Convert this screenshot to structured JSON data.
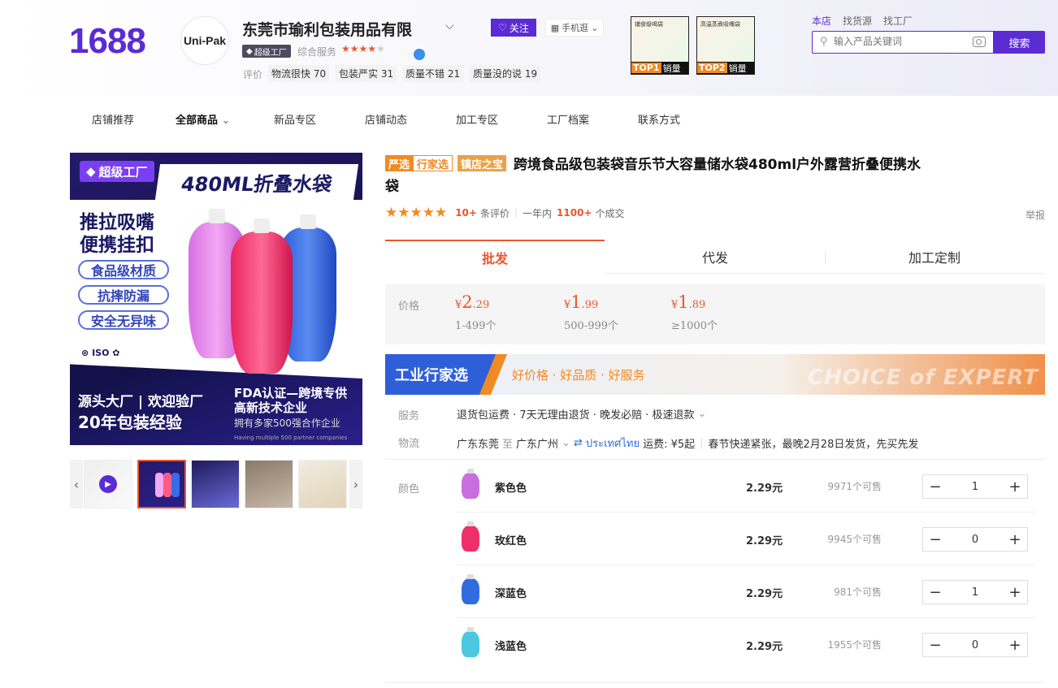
{
  "header": {
    "logo": "1688",
    "shop_avatar": "Uni-Pak",
    "shop_name": "东莞市瑜利包装用品有限",
    "follow_label": "关注",
    "mobile_label": "手机逛",
    "super_factory_badge": "超级工厂",
    "overall_service_label": "综合服务",
    "overall_stars": 4,
    "review_label": "评价",
    "review_chips": [
      "物流很快 70",
      "包装严实 31",
      "质量不错 21",
      "质量没的说 19"
    ],
    "top_products": [
      {
        "caption": "铺食级喝袋",
        "rank": "TOP1",
        "label": "销量"
      },
      {
        "caption": "高温蒸煮吸嘴袋",
        "rank": "TOP2",
        "label": "销量"
      }
    ],
    "search_scopes": [
      "本店",
      "找货源",
      "找工厂"
    ],
    "active_scope": "本店",
    "search_placeholder": "输入产品关键词",
    "search_button": "搜索"
  },
  "nav": {
    "items": [
      "店铺推荐",
      "全部商品",
      "新品专区",
      "店铺动态",
      "加工专区",
      "工厂档案",
      "联系方式"
    ],
    "active": "全部商品"
  },
  "gallery": {
    "main_image": {
      "sticker": "超级工厂",
      "headline": "480ML折叠水袋",
      "features_title": [
        "推拉吸嘴",
        "便携挂扣"
      ],
      "pills": [
        "食品级材质",
        "抗摔防漏",
        "安全无异味"
      ],
      "certs": "ISO",
      "bottom_left_1": "源头大厂 | 欢迎验厂",
      "bottom_left_2": "20年包装经验",
      "fda_line1": "FDA认证—跨境专供",
      "fda_line2": "高新技术企业",
      "fda_line3": "拥有多家500强合作企业",
      "fda_line4": "Having multiple 500 partner companies"
    },
    "thumb_count": 5,
    "selected_thumb": 1
  },
  "product": {
    "tags": [
      "严选",
      "行家选",
      "镇店之宝"
    ],
    "title": "跨境食品级包装袋音乐节大容量储水袋480ml户外露营折叠便携水袋",
    "stars": 5,
    "review_count": "10+",
    "review_unit": "条评价",
    "year_label": "一年内",
    "sales": "1100+",
    "sales_unit": "个成交",
    "report": "举报"
  },
  "mode_tabs": [
    "批发",
    "代发",
    "加工定制"
  ],
  "active_mode": "批发",
  "price": {
    "label": "价格",
    "currency": "¥",
    "tiers": [
      {
        "int": "2",
        "dec": ".29",
        "range": "1-499个"
      },
      {
        "int": "1",
        "dec": ".99",
        "range": "500-999个"
      },
      {
        "int": "1",
        "dec": ".89",
        "range": "≥1000个"
      }
    ]
  },
  "banner": {
    "title": "工业行家选",
    "slogan": "好价格 · 好品质 · 好服务",
    "watermark": "CHOICE of EXPERT"
  },
  "service": {
    "label": "服务",
    "value": "退货包运费 · 7天无理由退货 · 晚发必赔 · 极速退款"
  },
  "logistics": {
    "label": "物流",
    "from": "广东东莞",
    "to_word": "至",
    "to": "广东广州",
    "translate": "ประเทศไทย",
    "fee": "运费: ¥5起",
    "note": "春节快递紧张，最晚2月28日发货，先买先发"
  },
  "colors": {
    "label": "颜色",
    "items": [
      {
        "name": "紫色色",
        "price": "2.29元",
        "stock": "9971个可售",
        "qty": "1",
        "color": "#c86fe0"
      },
      {
        "name": "玫红色",
        "price": "2.29元",
        "stock": "9945个可售",
        "qty": "0",
        "color": "#ee2f6a"
      },
      {
        "name": "深蓝色",
        "price": "2.29元",
        "stock": "981个可售",
        "qty": "1",
        "color": "#2f6ce0"
      },
      {
        "name": "浅蓝色",
        "price": "2.29元",
        "stock": "1955个可售",
        "qty": "0",
        "color": "#4cc8e0"
      }
    ]
  },
  "colors_theme": {
    "brand": "#5b2bd4",
    "accent": "#e8582c",
    "orange": "#f08a24"
  }
}
